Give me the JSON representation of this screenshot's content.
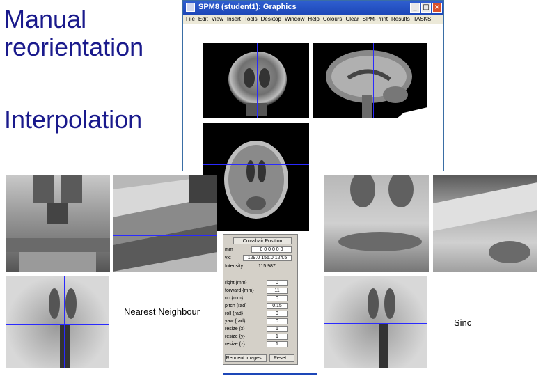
{
  "slide": {
    "heading_manual_line1": "Manual",
    "heading_manual_line2": "reorientation",
    "heading_interpolation": "Interpolation"
  },
  "spm_window": {
    "title": "SPM8 (student1): Graphics",
    "menu": [
      "File",
      "Edit",
      "View",
      "Insert",
      "Tools",
      "Desktop",
      "Window",
      "Help",
      "Colours",
      "Clear",
      "SPM-Print",
      "Results",
      "TASKS"
    ],
    "minimize_glyph": "_",
    "maximize_glyph": "□",
    "close_glyph": "×"
  },
  "reorient_panel": {
    "header": "Crosshair Position",
    "mm_label": "mm",
    "mm_value": "0 0 0 0 0 0",
    "vx_label": "vx:",
    "vx_value": "129.0 156.0 124.5",
    "intensity_label": "Intensity:",
    "intensity_value": "115.987",
    "params": [
      {
        "label": "right {mm}",
        "value": "0"
      },
      {
        "label": "forward {mm}",
        "value": "11"
      },
      {
        "label": "up {mm}",
        "value": "0"
      },
      {
        "label": "pitch {rad}",
        "value": "0.15"
      },
      {
        "label": "roll {rad}",
        "value": "0"
      },
      {
        "label": "yaw {rad}",
        "value": "0"
      },
      {
        "label": "resize {x}",
        "value": "1"
      },
      {
        "label": "resize {y}",
        "value": "1"
      },
      {
        "label": "resize {z}",
        "value": "1"
      }
    ],
    "reorient_button": "Reorient images...",
    "reset_button": "Reset..."
  },
  "captions": {
    "nearest": "Nearest Neighbour",
    "sinc": "Sinc"
  },
  "colors": {
    "heading": "#1a1a8c",
    "crosshair": "#2a2aff",
    "title_bar": "#2f5fd0"
  }
}
